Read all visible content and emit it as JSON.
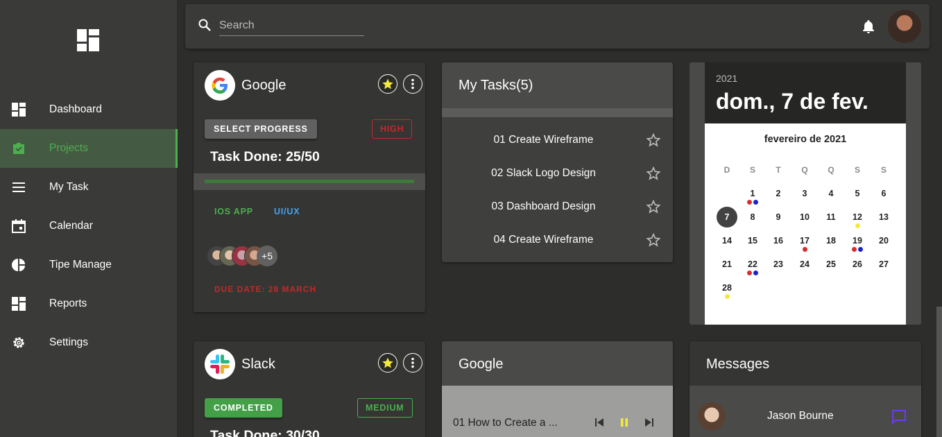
{
  "sidebar": {
    "items": [
      {
        "label": "Dashboard",
        "icon": "dashboard-icon"
      },
      {
        "label": "Projects",
        "icon": "briefcase-icon",
        "active": true
      },
      {
        "label": "My Task",
        "icon": "list-icon"
      },
      {
        "label": "Calendar",
        "icon": "calendar-icon"
      },
      {
        "label": "Tipe Manage",
        "icon": "pie-chart-icon"
      },
      {
        "label": "Reports",
        "icon": "reports-icon"
      },
      {
        "label": "Settings",
        "icon": "gear-icon"
      }
    ]
  },
  "topbar": {
    "search_placeholder": "Search"
  },
  "project_google": {
    "title": "Google",
    "progress_button": "SELECT PROGRESS",
    "priority": "HIGH",
    "task_done": "Task Done: 25/50",
    "progress": 1.0,
    "tags": [
      "IOS APP",
      "UI/UX"
    ],
    "members_more": "+5",
    "due_date": "DUE DATE: 28 MARCH"
  },
  "project_slack": {
    "title": "Slack",
    "status": "COMPLETED",
    "priority": "MEDIUM",
    "task_done": "Task Done: 30/30"
  },
  "tasks": {
    "title": "My Tasks(5)",
    "items": [
      "01 Create Wireframe",
      "02 Slack Logo Design",
      "03 Dashboard Design",
      "04 Create Wireframe"
    ]
  },
  "calendar": {
    "year": "2021",
    "selected_label": "dom., 7 de fev.",
    "month_label": "fevereiro de 2021",
    "dow": [
      "D",
      "S",
      "T",
      "Q",
      "Q",
      "S",
      "S"
    ],
    "first_weekday": 1,
    "days_in_month": 28,
    "selected_day": 7,
    "events": {
      "1": [
        "#d32f2f",
        "#1a23c9"
      ],
      "12": [
        "#f5e93a"
      ],
      "17": [
        "#d32f2f"
      ],
      "19": [
        "#d32f2f",
        "#1a23c9"
      ],
      "22": [
        "#d32f2f",
        "#1a23c9"
      ],
      "28": [
        "#f5e93a"
      ]
    }
  },
  "media": {
    "title": "Google",
    "track": "01 How to Create a ..."
  },
  "messages": {
    "title": "Messages",
    "items": [
      {
        "name": "Jason Bourne"
      }
    ]
  },
  "colors": {
    "accent_green": "#4caf50",
    "high": "#c62828",
    "tag_green": "#4caf50",
    "tag_blue": "#42a5f5",
    "star_yellow": "#f5e93a",
    "message_icon": "#6a3de8"
  }
}
